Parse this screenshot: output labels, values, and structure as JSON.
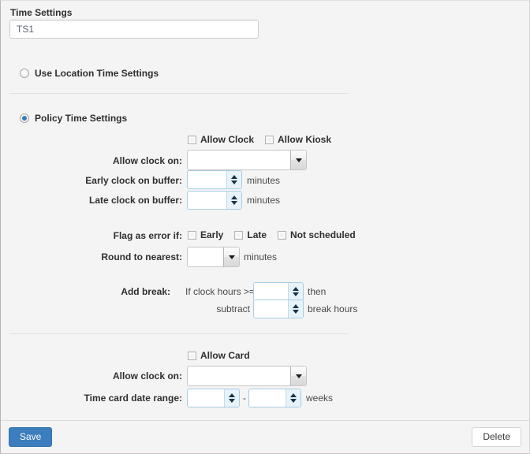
{
  "form": {
    "name_field": {
      "label": "Time Settings",
      "value": "TS1",
      "placeholder": ""
    },
    "mode_options": [
      {
        "label": "Use Location Time Settings",
        "selected": false
      },
      {
        "label": "Policy Time Settings",
        "selected": true
      }
    ]
  },
  "policy_section": {
    "checkboxes": [
      {
        "label": "Allow Clock",
        "checked": false
      },
      {
        "label": "Allow Kiosk",
        "checked": false
      }
    ],
    "allow_clock_on": {
      "label": "Allow clock on:",
      "value": "",
      "options": []
    },
    "early_buffer": {
      "label": "Early clock on buffer:",
      "value": "",
      "unit": "minutes"
    },
    "late_buffer": {
      "label": "Late clock on buffer:",
      "value": "",
      "unit": "minutes"
    },
    "flag_as_error": {
      "label": "Flag as error if:",
      "checkboxes": [
        {
          "label": "Early",
          "checked": false
        },
        {
          "label": "Late",
          "checked": false
        },
        {
          "label": "Not scheduled",
          "checked": false
        }
      ]
    },
    "round_to_nearest": {
      "label": "Round to nearest:",
      "value": "",
      "unit": "minutes",
      "options": []
    },
    "add_break": {
      "label": "Add break:",
      "if_label": "If clock hours >=",
      "if_value": "",
      "then_label": "then",
      "subtract_label": "subtract",
      "subtract_value": "",
      "break_hours_label": "break hours"
    }
  },
  "card_section": {
    "checkboxes": [
      {
        "label": "Allow Card",
        "checked": false
      }
    ],
    "allow_clock_on": {
      "label": "Allow clock on:",
      "value": "",
      "options": []
    },
    "time_card_date_range": {
      "label": "Time card date range:",
      "from_value": "",
      "separator": "-",
      "to_value": "",
      "unit": "weeks"
    }
  },
  "footer": {
    "save_label": "Save",
    "delete_label": "Delete"
  },
  "colors": {
    "accent": "#3b7dbd",
    "background": "#f4f4f4",
    "spinner_border": "#a7cde4",
    "radio_dot": "#3a79ba"
  }
}
